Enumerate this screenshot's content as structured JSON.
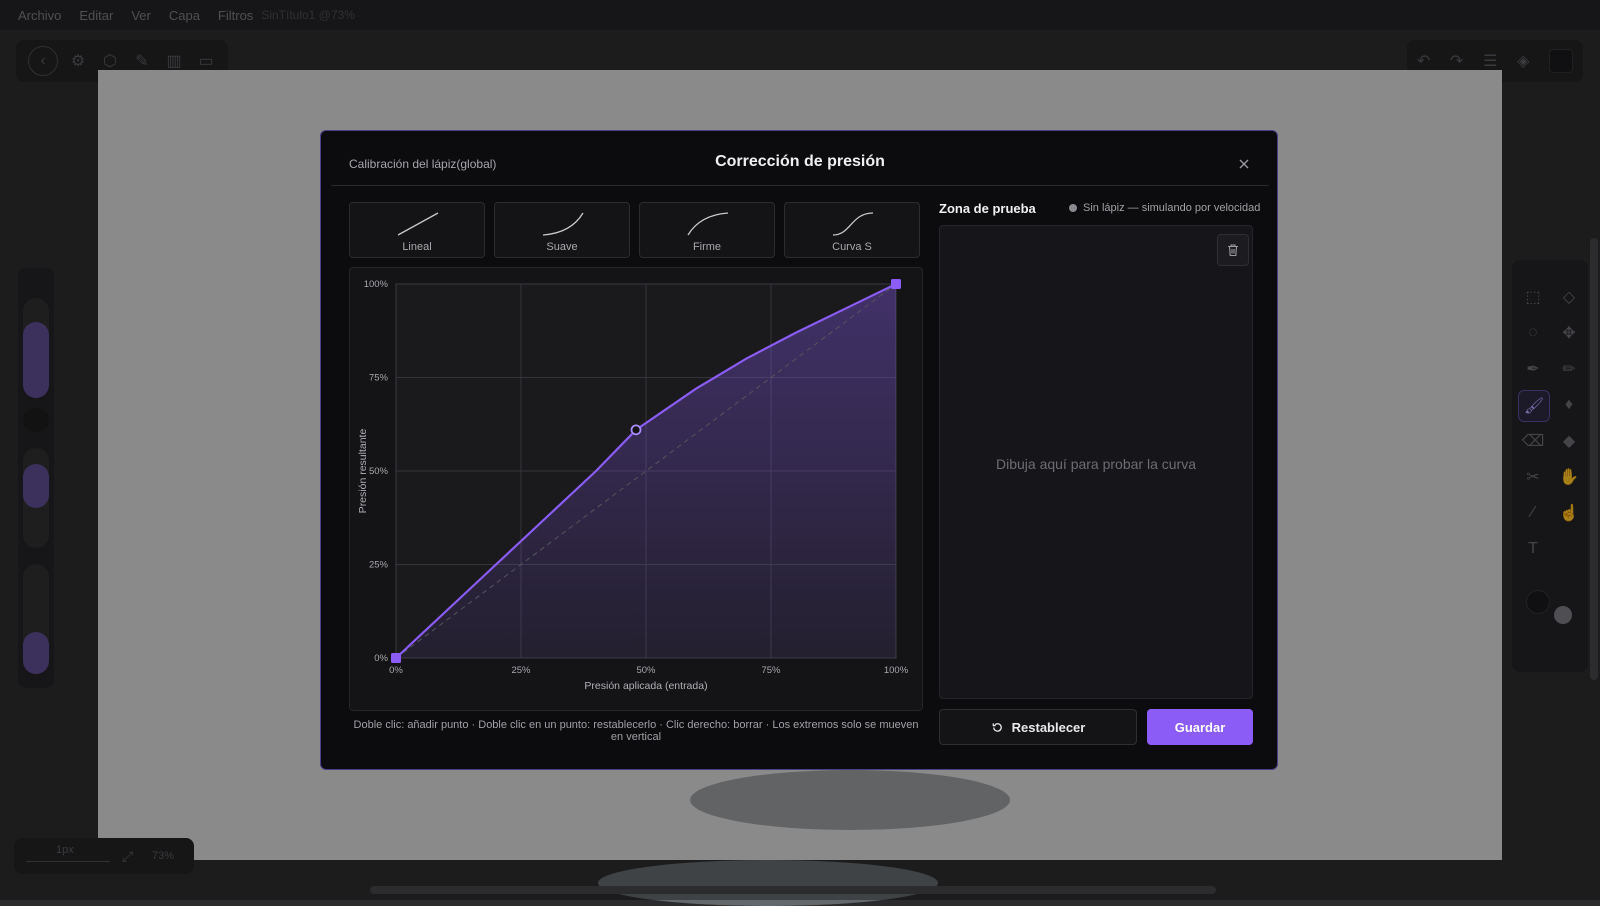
{
  "menu": {
    "items": [
      "Archivo",
      "Editar",
      "Ver",
      "Capa",
      "Filtros"
    ],
    "document_title": "SinTítulo1 @73%"
  },
  "bottombar": {
    "size_label": "1px",
    "zoom_label": "73%"
  },
  "dialog": {
    "subtitle": "Calibración del lápiz(global)",
    "title": "Corrección de presión",
    "presets": [
      {
        "label": "Lineal"
      },
      {
        "label": "Suave"
      },
      {
        "label": "Firme"
      },
      {
        "label": "Curva S"
      }
    ],
    "hint": "Doble clic: añadir punto · Doble clic en un punto: restablecerlo · Clic derecho: borrar · Los extremos solo se mueven en vertical",
    "test_zone": {
      "title": "Zona de prueba",
      "status": "Sin lápiz — simulando por velocidad",
      "placeholder": "Dibuja aquí para probar la curva"
    },
    "buttons": {
      "reset": "Restablecer",
      "save": "Guardar"
    }
  },
  "colors": {
    "accent": "#8b5cf6",
    "dialog_bg": "#0c0c0e",
    "border": "#4a3f8c"
  },
  "chart_data": {
    "type": "line",
    "xlabel": "Presión aplicada (entrada)",
    "ylabel": "Presión resultante",
    "xticks": [
      "0%",
      "25%",
      "50%",
      "75%",
      "100%"
    ],
    "yticks": [
      "0%",
      "25%",
      "50%",
      "75%",
      "100%"
    ],
    "xlim": [
      0,
      100
    ],
    "ylim": [
      0,
      100
    ],
    "grid": true,
    "series": [
      {
        "x": [
          0,
          10,
          20,
          30,
          40,
          48,
          60,
          70,
          80,
          90,
          100
        ],
        "y": [
          0,
          12.5,
          25,
          37.5,
          50,
          61,
          72,
          80,
          87,
          93.5,
          100
        ]
      },
      {
        "x": [
          0,
          100
        ],
        "y": [
          0,
          100
        ]
      }
    ],
    "control_points": [
      {
        "x": 0,
        "y": 0
      },
      {
        "x": 48,
        "y": 61
      },
      {
        "x": 100,
        "y": 100
      }
    ]
  }
}
